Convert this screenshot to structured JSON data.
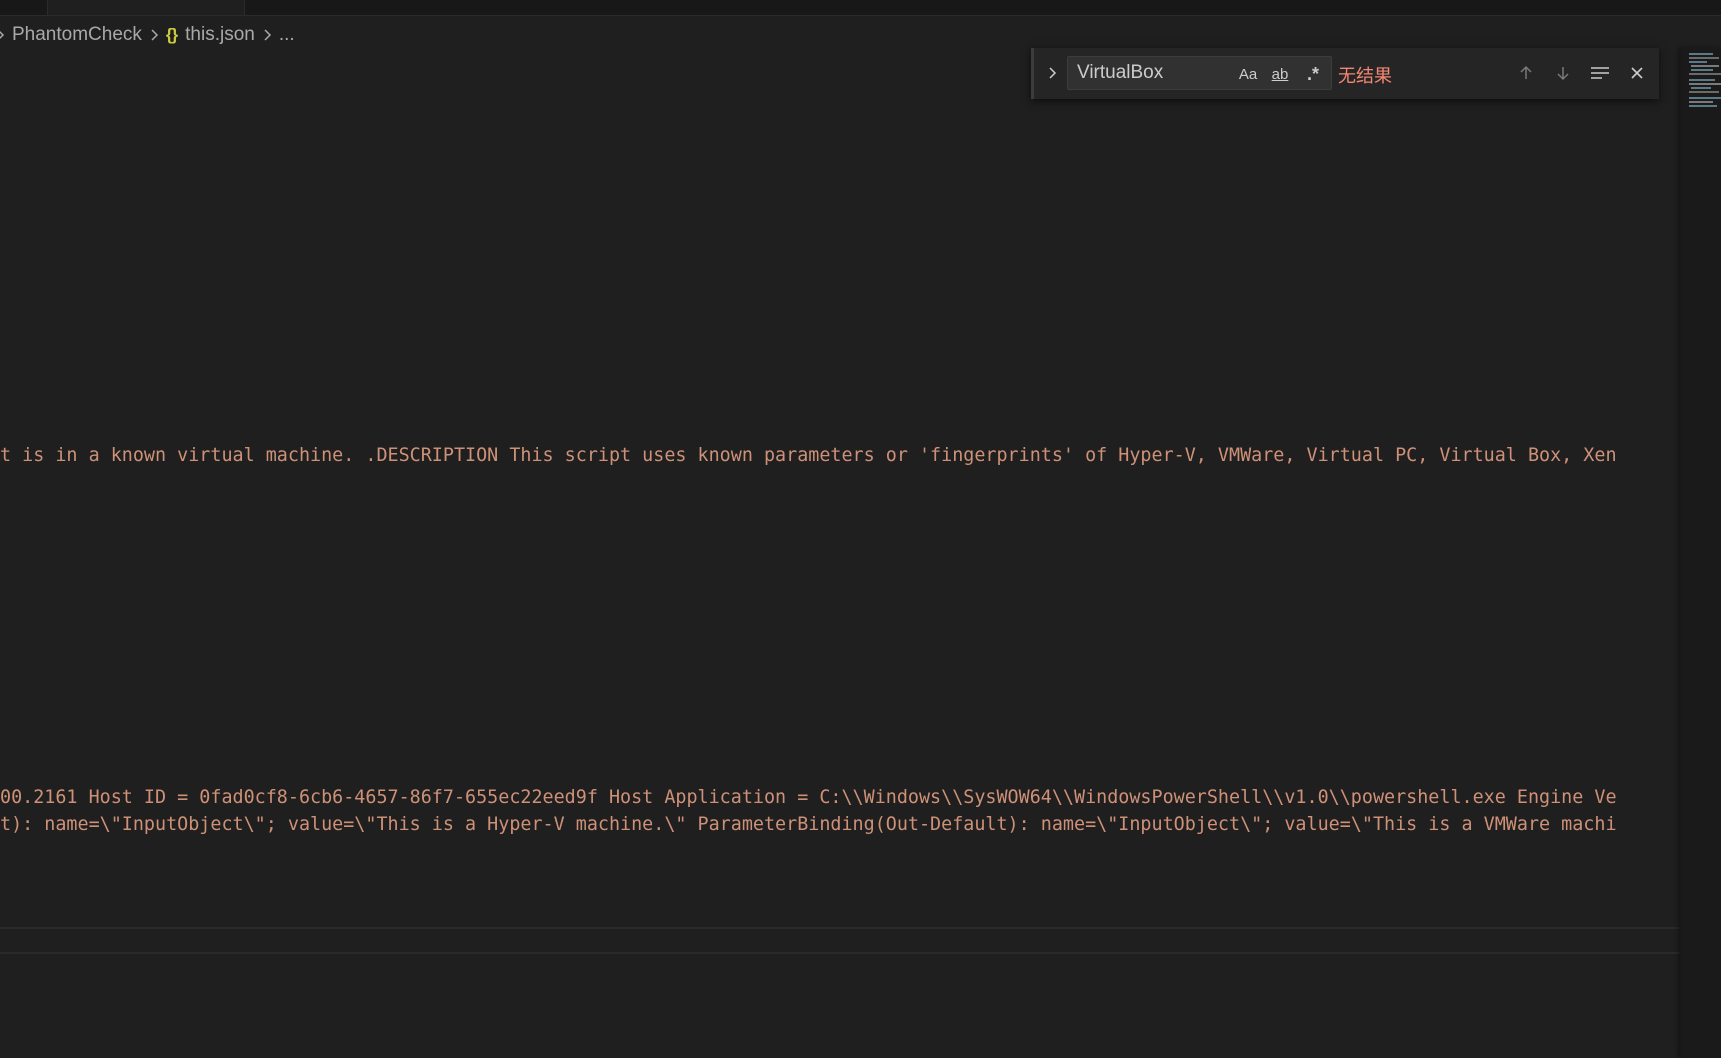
{
  "breadcrumb": {
    "folder": "PhantomCheck",
    "file": "this.json",
    "tail": "...",
    "json_icon": "{}"
  },
  "find": {
    "value": "VirtualBox",
    "match_case_label": "Aa",
    "whole_word_label": "ab",
    "regex_label": ".*",
    "result": "无结果"
  },
  "code_lines": [
    "t is in a known virtual machine. .DESCRIPTION This script uses known parameters or 'fingerprints' of Hyper-V, VMWare, Virtual PC, Virtual Box, Xen",
    "00.2161 Host ID = 0fad0cf8-6cb6-4657-86f7-655ec22eed9f Host Application = C:\\\\Windows\\\\SysWOW64\\\\WindowsPowerShell\\\\v1.0\\\\powershell.exe Engine Ve",
    "t): name=\\\"InputObject\\\"; value=\\\"This is a Hyper-V machine.\\\" ParameterBinding(Out-Default): name=\\\"InputObject\\\"; value=\\\"This is a VMWare machi"
  ],
  "colors": {
    "editor_bg": "#1f1f1f",
    "string": "#ce9178",
    "no_result": "#f48771",
    "json_icon": "#cbcb41"
  },
  "icons": {
    "breadcrumb_separator": "chevron-right-icon",
    "toggle_replace": "chevron-right-icon",
    "previous_match": "arrow-up-icon",
    "next_match": "arrow-down-icon",
    "find_in_selection": "selection-lines-icon",
    "close": "close-icon"
  }
}
